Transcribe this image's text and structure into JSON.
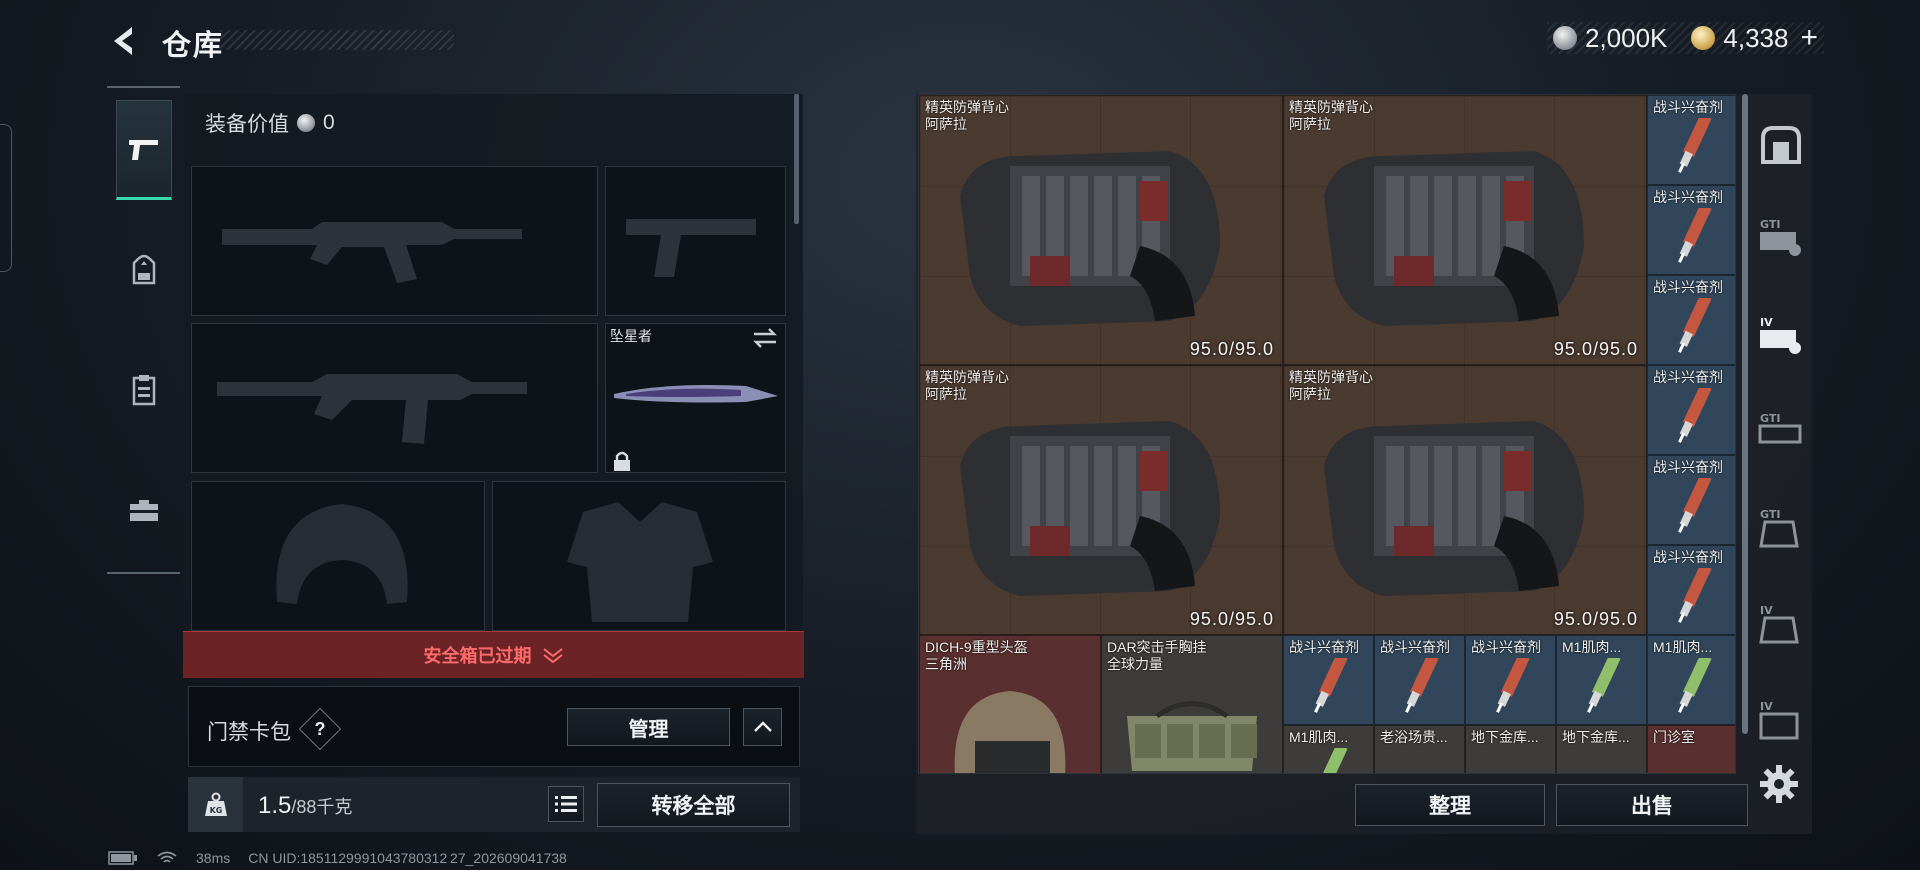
{
  "header": {
    "title": "仓库",
    "silver": "2,000K",
    "gold": "4,338",
    "plus": "+"
  },
  "category_tabs": [
    {
      "name": "weapons",
      "icon": "pistol-icon",
      "active": true
    },
    {
      "name": "gear",
      "icon": "backpack-icon",
      "active": false
    },
    {
      "name": "consumables",
      "icon": "clipboard-icon",
      "active": false
    },
    {
      "name": "toolbox",
      "icon": "toolbox-icon",
      "active": false
    }
  ],
  "loadout": {
    "equip_value_label": "装备价值",
    "equip_value": "0",
    "melee_name": "坠星者",
    "safebox_status": "安全箱已过期",
    "keycard_label": "门禁卡包",
    "help": "?",
    "manage": "管理",
    "weight": "1.5",
    "weight_max": "/88千克",
    "transfer_all": "转移全部"
  },
  "storage": {
    "vests": [
      {
        "name": "精英防弹背心",
        "sub": "阿萨拉",
        "durability": "95.0/95.0"
      },
      {
        "name": "精英防弹背心",
        "sub": "阿萨拉",
        "durability": "95.0/95.0"
      },
      {
        "name": "精英防弹背心",
        "sub": "阿萨拉",
        "durability": "95.0/95.0"
      },
      {
        "name": "精英防弹背心",
        "sub": "阿萨拉",
        "durability": "95.0/95.0"
      }
    ],
    "stim_column": [
      "战斗兴奋剂",
      "战斗兴奋剂",
      "战斗兴奋剂",
      "战斗兴奋剂",
      "战斗兴奋剂",
      "战斗兴奋剂"
    ],
    "helmet": {
      "name": "DICH-9重型头盔",
      "sub": "三角洲"
    },
    "rig": {
      "name": "DAR突击手胸挂",
      "sub": "全球力量"
    },
    "small_row1": [
      "战斗兴奋剂",
      "战斗兴奋剂",
      "战斗兴奋剂",
      "M1肌肉...",
      "M1肌肉..."
    ],
    "small_row2": [
      "M1肌肉...",
      "老浴场贵...",
      "地下金库...",
      "地下金库...",
      "门诊室"
    ],
    "sort": "整理",
    "sell": "出售"
  },
  "right_rail": [
    "safe-icon",
    "gti-key-icon",
    "iv-key-icon",
    "gti-card-icon",
    "gti-bag-icon",
    "iv-bag-icon",
    "iv-box-icon"
  ],
  "status": {
    "ping": "38ms",
    "uid": "CN UID:1851129991043780312 27_202609041738"
  },
  "colors": {
    "accent": "#38d9a9",
    "danger": "#ff6b6b",
    "danger_bg": "#6b2326",
    "vest_bg": "#4b3a30",
    "stim_bg": "#31465a"
  }
}
